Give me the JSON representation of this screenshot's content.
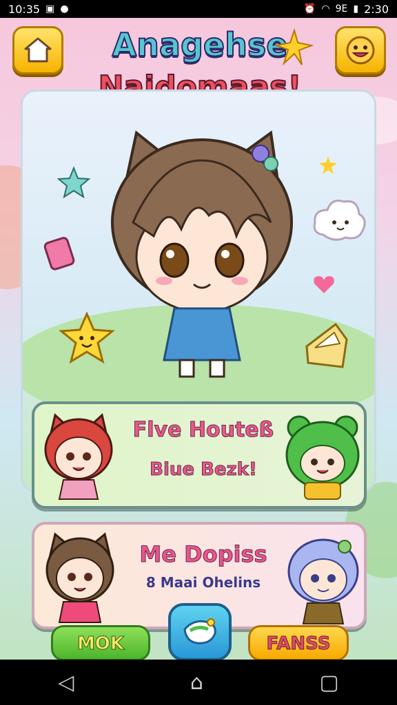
{
  "status_bar": {
    "left_time": "10:35",
    "right_time": "2:30",
    "signal_text": "9E"
  },
  "header": {
    "title_line1": "Anagehse",
    "title_line2": "Naidomaas!",
    "home_icon": "home-icon",
    "smiley_icon": "smiley-face-icon"
  },
  "main_card": {
    "character": "chibi-girl-cat-ears",
    "stickers": [
      "star-icon",
      "cloud-face-icon",
      "heart-icon",
      "gift-icon",
      "sparkle-icon"
    ]
  },
  "panel1": {
    "title": "Flve Houteß",
    "subtitle": "Biue Bezk!"
  },
  "panel2": {
    "title": "Me Dopiss",
    "subtitle": "8 Maai Ohelins"
  },
  "bottom_buttons": {
    "left_label": "MOK",
    "right_label": "FANSS",
    "center_icon": "ticket-icon"
  },
  "colors": {
    "accent_pink": "#e85a8c",
    "button_green": "#4bb52c",
    "button_yellow": "#f7a900",
    "button_blue": "#2a97d6"
  }
}
